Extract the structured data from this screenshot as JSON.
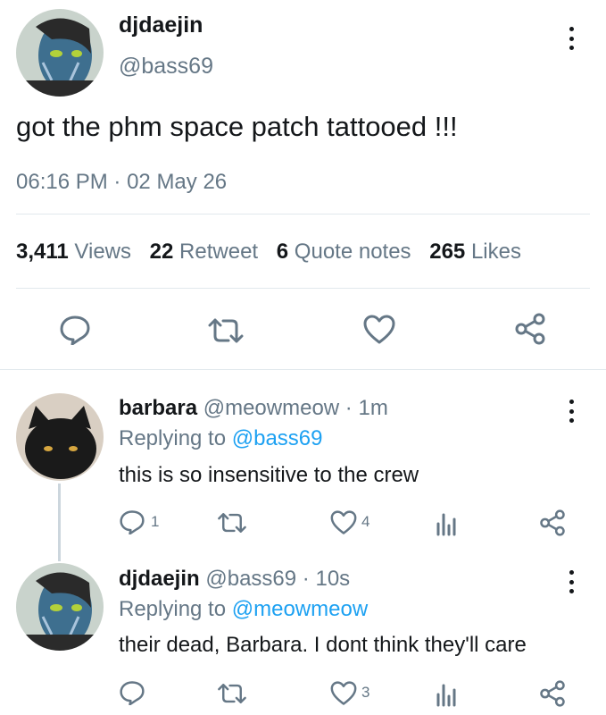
{
  "main_tweet": {
    "display_name": "djdaejin",
    "handle": "@bass69",
    "text": "got the phm space patch tattooed !!!",
    "time": "06:16 PM",
    "date": "02 May 26",
    "stats": {
      "views_count": "3,411",
      "views_label": "Views",
      "retweet_count": "22",
      "retweet_label": "Retweet",
      "quote_count": "6",
      "quote_label": "Quote notes",
      "likes_count": "265",
      "likes_label": "Likes"
    }
  },
  "replies": [
    {
      "display_name": "barbara",
      "handle": "@meowmeow",
      "age": "1m",
      "replying_prefix": "Replying to",
      "replying_handle": "@bass69",
      "text": "this is so insensitive to the crew",
      "reply_count": "1",
      "like_count": "4"
    },
    {
      "display_name": "djdaejin",
      "handle": "@bass69",
      "age": "10s",
      "replying_prefix": "Replying to",
      "replying_handle": "@meowmeow",
      "text": "their dead, Barbara. I dont think they'll care",
      "like_count": "3"
    }
  ],
  "separator": "·",
  "colors": {
    "accent": "#1da1f2",
    "muted": "#657786",
    "text": "#14171a",
    "divider": "#e1e8ed"
  }
}
